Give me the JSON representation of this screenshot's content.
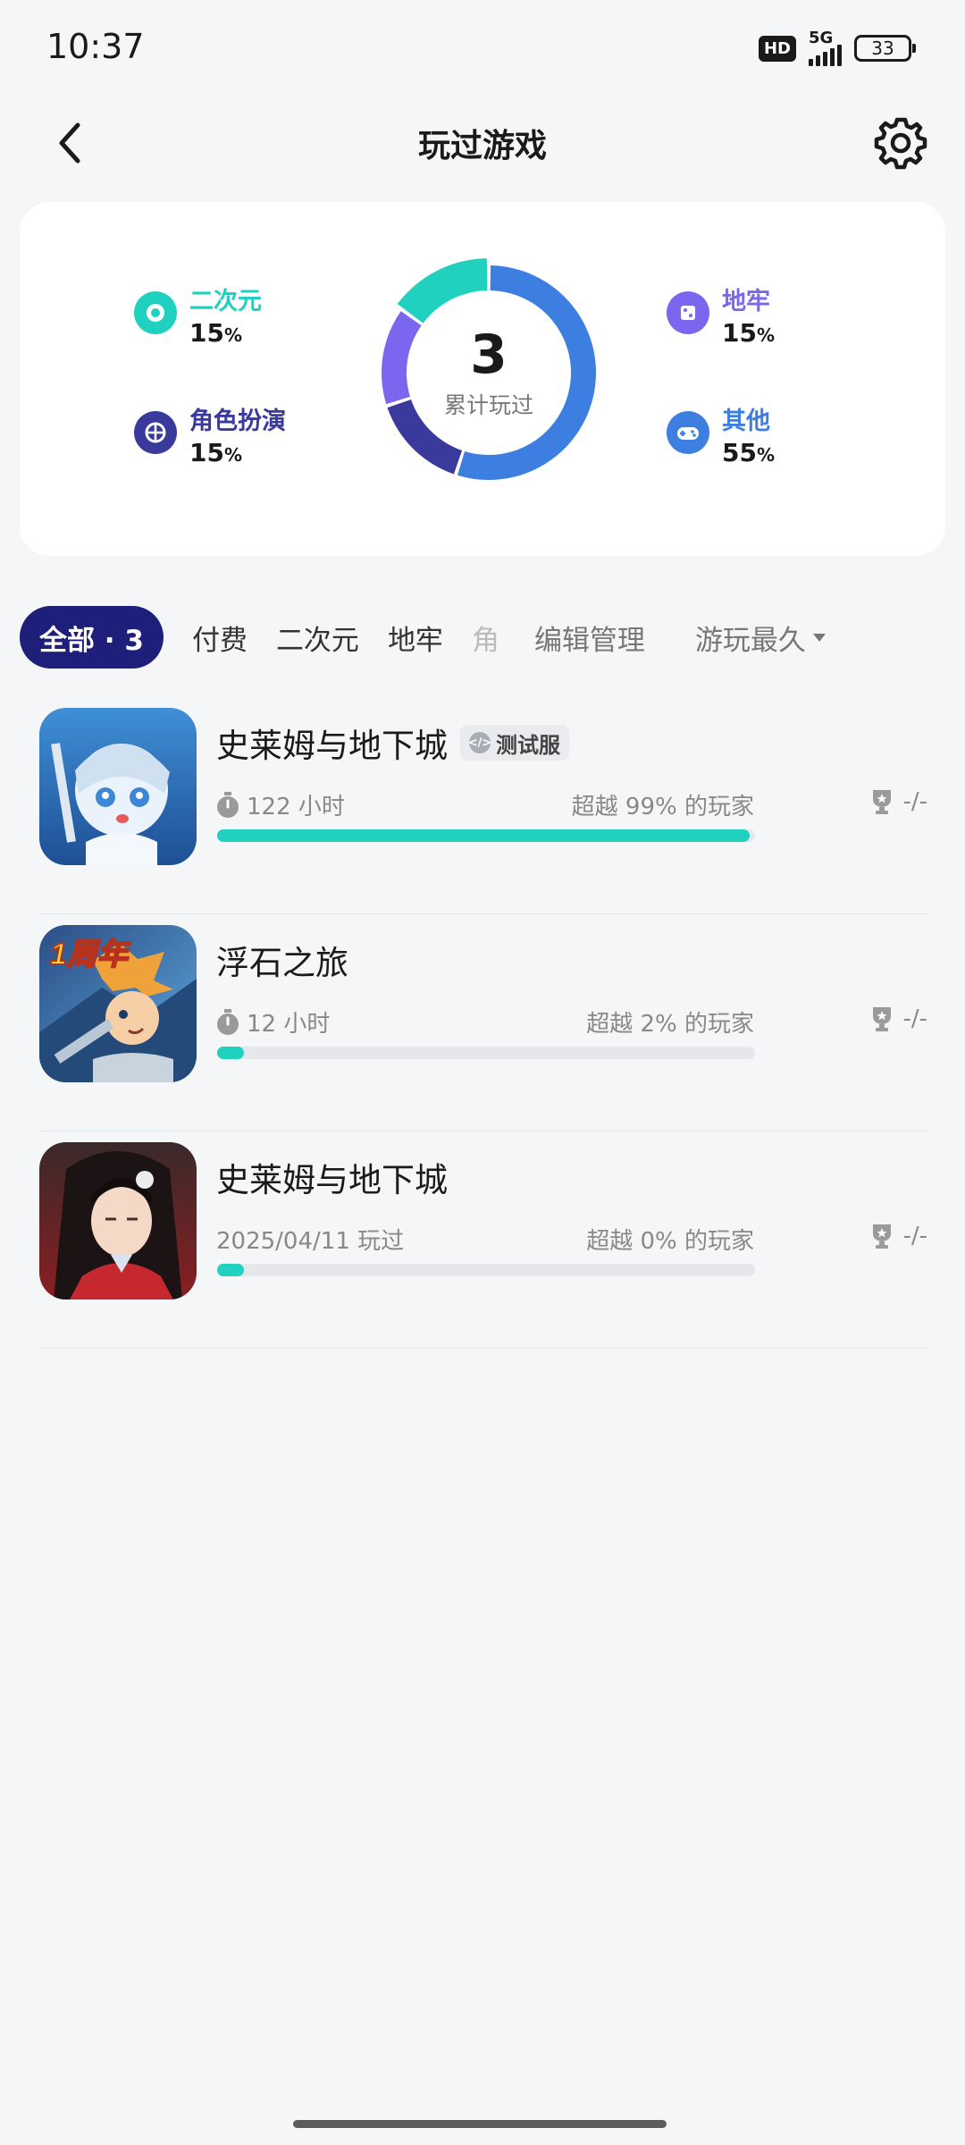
{
  "status_bar": {
    "time": "10:37",
    "hd_label": "HD",
    "network": "5G",
    "battery": "33"
  },
  "header": {
    "title": "玩过游戏"
  },
  "stats": {
    "total": "3",
    "total_caption": "累计玩过",
    "categories": [
      {
        "name": "二次元",
        "percent": "15",
        "unit": "%",
        "color": "#1fd1be",
        "icon": "anime-icon"
      },
      {
        "name": "角色扮演",
        "percent": "15",
        "unit": "%",
        "color": "#3a3a9c",
        "icon": "rpg-icon"
      },
      {
        "name": "地牢",
        "percent": "15",
        "unit": "%",
        "color": "#7b66f0",
        "icon": "dungeon-icon"
      },
      {
        "name": "其他",
        "percent": "55",
        "unit": "%",
        "color": "#3c7fe0",
        "icon": "gamepad-icon"
      }
    ]
  },
  "filters": {
    "active": "全部 · 3",
    "chips": [
      "付费",
      "二次元",
      "地牢",
      "角"
    ],
    "edit_label": "编辑管理",
    "sort_label": "游玩最久"
  },
  "games": [
    {
      "title": "史莱姆与地下城",
      "badge": "测试服",
      "time_text": "122 小时",
      "rank_text": "超越 99% 的玩家",
      "progress": 0.99,
      "trophy": "-/-"
    },
    {
      "title": "浮石之旅",
      "time_text": "12 小时",
      "rank_text": "超越 2% 的玩家",
      "progress": 0.05,
      "trophy": "-/-",
      "thumb_label": "1周年"
    },
    {
      "title": "史莱姆与地下城",
      "date_text": "2025/04/11 玩过",
      "rank_text": "超越 0% 的玩家",
      "progress": 0.05,
      "trophy": "-/-"
    }
  ]
}
